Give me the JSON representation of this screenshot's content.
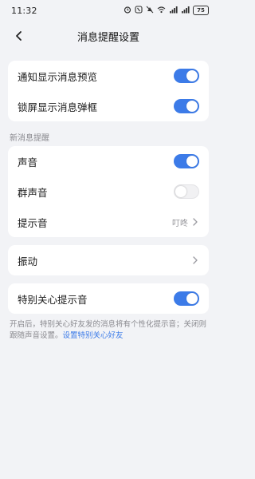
{
  "status_bar": {
    "time": "11:32",
    "icons": [
      "alarm-icon",
      "nfc-icon",
      "mute-icon",
      "wifi-icon",
      "signal-icon",
      "signal-icon"
    ],
    "battery": "75"
  },
  "header": {
    "back_icon": "chevron-left-icon",
    "title": "消息提醒设置"
  },
  "group1": {
    "items": [
      {
        "label": "通知显示消息预览",
        "toggle": true
      },
      {
        "label": "锁屏显示消息弹框",
        "toggle": true
      }
    ]
  },
  "section2": {
    "title": "新消息提醒",
    "sound": {
      "label": "声音",
      "toggle": true
    },
    "group_sound": {
      "label": "群声音",
      "toggle": false
    },
    "tone": {
      "label": "提示音",
      "value": "叮咚"
    }
  },
  "vibration": {
    "label": "振动"
  },
  "special": {
    "label": "特别关心提示音",
    "toggle": true
  },
  "footer": {
    "text": "开启后，特别关心好友发的消息将有个性化提示音；关闭则跟随声音设置。",
    "link": "设置特别关心好友"
  },
  "colors": {
    "accent": "#3c7be8",
    "background": "#f2f3f6",
    "card": "#ffffff"
  }
}
